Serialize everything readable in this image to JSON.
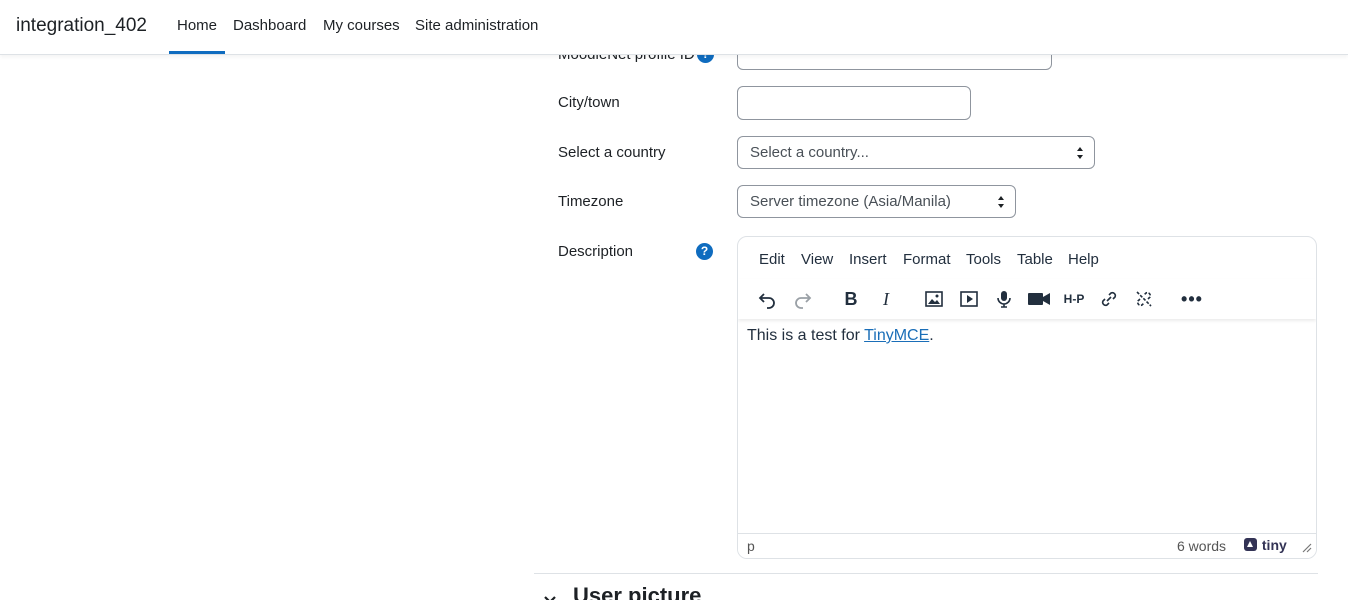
{
  "navbar": {
    "brand": "integration_402",
    "items": [
      {
        "label": "Home",
        "active": true
      },
      {
        "label": "Dashboard"
      },
      {
        "label": "My courses"
      },
      {
        "label": "Site administration"
      }
    ]
  },
  "form": {
    "moodlenet_label": "MoodleNet profile ID",
    "city_label": "City/town",
    "city_value": "",
    "country_label": "Select a country",
    "country_value": "Select a country...",
    "timezone_label": "Timezone",
    "timezone_value": "Server timezone (Asia/Manila)",
    "description_label": "Description",
    "help_glyph": "?"
  },
  "editor": {
    "menu": [
      "Edit",
      "View",
      "Insert",
      "Format",
      "Tools",
      "Table",
      "Help"
    ],
    "content_text": "This is a test for ",
    "content_link": "TinyMCE",
    "content_end": ".",
    "status_path": "p",
    "word_count": "6 words",
    "brand": "tiny",
    "toolbar_icons": [
      "undo-icon",
      "redo-icon",
      "bold-icon",
      "italic-icon",
      "image-icon",
      "media-icon",
      "microphone-icon",
      "video-icon",
      "h5p-icon",
      "link-icon",
      "unlink-icon",
      "more-icon"
    ]
  },
  "section": {
    "title": "User picture"
  },
  "colors": {
    "accent": "#0f6cbf",
    "help": "#0f6cbf"
  }
}
